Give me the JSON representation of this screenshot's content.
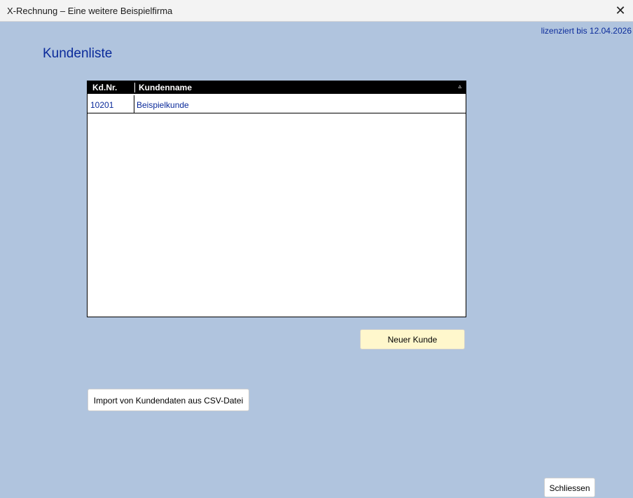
{
  "window": {
    "title": "X-Rechnung – Eine weitere Beispielfirma",
    "close_glyph": "✕"
  },
  "license_text": "lizenziert bis 12.04.2026",
  "page_title": "Kundenliste",
  "table": {
    "columns": [
      "Kd.Nr.",
      "Kundenname"
    ],
    "sort_glyph": "▵",
    "rows": [
      {
        "kdnr": "10201",
        "name": "Beispielkunde"
      }
    ]
  },
  "buttons": {
    "new_customer": "Neuer Kunde",
    "import_csv": "Import von Kundendaten aus CSV-Datei",
    "close": "Schliessen"
  },
  "colors": {
    "background": "#b0c4de",
    "accent_text": "#0a2a9a",
    "new_button_bg": "#fff7cc"
  }
}
